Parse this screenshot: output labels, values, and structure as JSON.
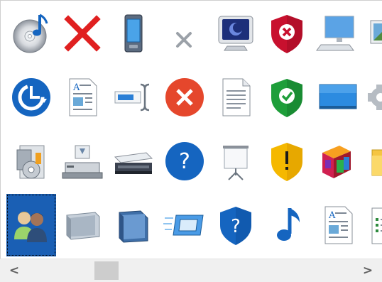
{
  "icon_grid": {
    "selected_icon": "users-group-icon",
    "rows": [
      [
        "cd-music-icon",
        "red-x-icon",
        "pda-device-icon",
        "small-gray-x-icon",
        "crt-monitor-icon",
        "shield-error-icon",
        "desktop-computer-icon",
        "picture-icon-partial"
      ],
      [
        "clock-refresh-icon",
        "document-picture-icon",
        "text-cursor-field-icon",
        "error-circle-icon",
        "text-document-icon",
        "shield-check-icon",
        "blue-display-icon",
        "gear-icon-partial"
      ],
      [
        "media-player-box-icon",
        "printer-scanner-icon",
        "flatbed-scanner-icon",
        "help-circle-icon",
        "projector-screen-icon",
        "shield-warning-icon",
        "colorful-blocks-icon",
        "folder-icon-partial"
      ],
      [
        "users-group-icon",
        "gray-panel-icon",
        "blue-folder-icon",
        "fast-window-icon",
        "shield-help-icon",
        "music-note-icon",
        "document-picture-icon-2",
        "spreadsheet-icon-partial"
      ]
    ]
  },
  "scrollbar": {
    "left_arrow": "<",
    "right_arrow": ">",
    "left_arrow_icon": "chevron-left-icon",
    "right_arrow_icon": "chevron-right-icon"
  },
  "colors": {
    "selection": "#1a5fb4",
    "shield_red": "#c8102e",
    "shield_green": "#1e9e3a",
    "shield_yellow": "#f5b800",
    "accent_blue": "#1565c0"
  }
}
